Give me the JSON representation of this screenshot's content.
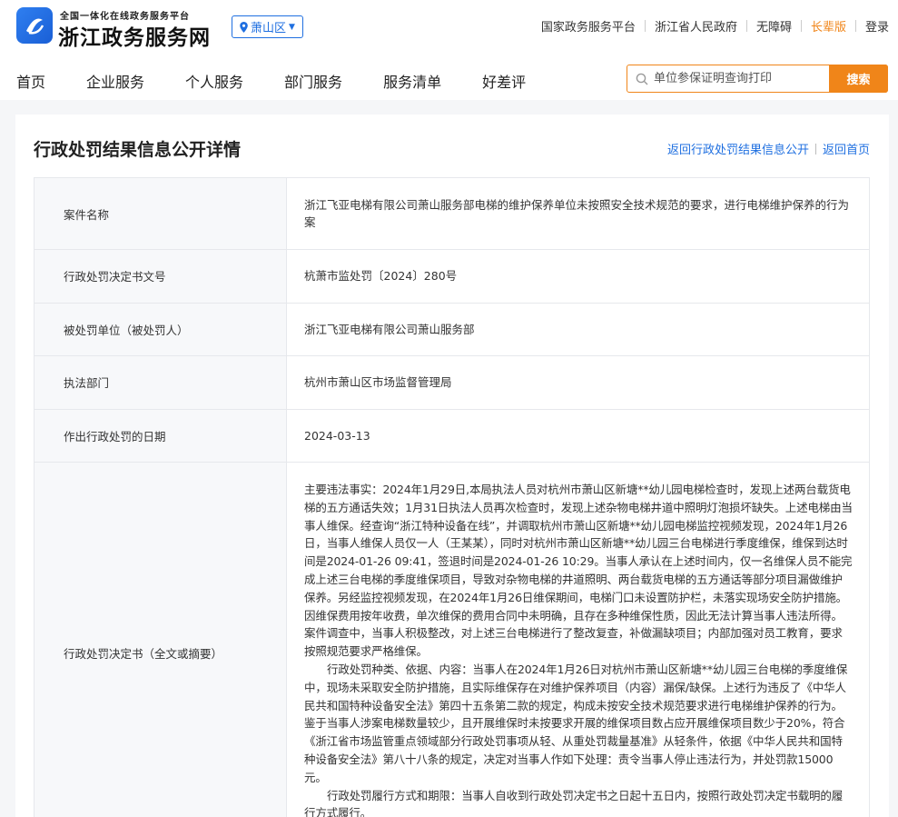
{
  "header": {
    "brand_small": "全国一体化在线政务服务平台",
    "brand_big": "浙江政务服务网",
    "region": "萧山区",
    "top_links": [
      "国家政务服务平台",
      "浙江省人民政府",
      "无障碍",
      "长辈版",
      "登录"
    ],
    "nav": [
      "首页",
      "企业服务",
      "个人服务",
      "部门服务",
      "服务清单",
      "好差评"
    ],
    "search": {
      "placeholder": "单位参保证明查询打印",
      "button": "搜索"
    },
    "colors": {
      "accent": "#f08519",
      "link": "#1f6fe0"
    }
  },
  "page": {
    "title": "行政处罚结果信息公开详情",
    "back_list": "返回行政处罚结果信息公开",
    "back_home": "返回首页"
  },
  "rows": [
    {
      "key": "案件名称",
      "value": "浙江飞亚电梯有限公司萧山服务部电梯的维护保养单位未按照安全技术规范的要求，进行电梯维护保养的行为案"
    },
    {
      "key": "行政处罚决定书文号",
      "value": "杭萧市监处罚〔2024〕280号"
    },
    {
      "key": "被处罚单位（被处罚人）",
      "value": "浙江飞亚电梯有限公司萧山服务部"
    },
    {
      "key": "执法部门",
      "value": "杭州市萧山区市场监督管理局"
    },
    {
      "key": "作出行政处罚的日期",
      "value": "2024-03-13"
    },
    {
      "key": "行政处罚决定书（全文或摘要）",
      "paragraphs": [
        "主要违法事实：2024年1月29日,本局执法人员对杭州市萧山区新塘**幼儿园电梯检查时，发现上述两台载货电梯的五方通话失效；1月31日执法人员再次检查时，发现上述杂物电梯井道中照明灯泡损坏缺失。上述电梯由当事人维保。经查询“浙江特种设备在线”，并调取杭州市萧山区新塘**幼儿园电梯监控视频发现，2024年1月26日，当事人维保人员仅一人（王某某），同时对杭州市萧山区新塘**幼儿园三台电梯进行季度维保，维保到达时间是2024-01-26 09:41，签退时间是2024-01-26 10:29。当事人承认在上述时间内，仅一名维保人员不能完成上述三台电梯的季度维保项目，导致对杂物电梯的井道照明、两台载货电梯的五方通话等部分项目漏做维护保养。另经监控视频发现，在2024年1月26日维保期间，电梯门口未设置防护栏，未落实现场安全防护措施。因维保费用按年收费，单次维保的费用合同中未明确，且存在多种维保性质，因此无法计算当事人违法所得。案件调查中，当事人积极整改，对上述三台电梯进行了整改复查，补做漏缺项目；内部加强对员工教育，要求按照规范要求严格维保。",
        "行政处罚种类、依据、内容：当事人在2024年1月26日对杭州市萧山区新塘**幼儿园三台电梯的季度维保中，现场未采取安全防护措施，且实际维保存在对维护保养项目（内容）漏保/缺保。上述行为违反了《中华人民共和国特种设备安全法》第四十五条第二款的规定，构成未按安全技术规范要求进行电梯维护保养的行为。鉴于当事人涉案电梯数量较少，且开展维保时未按要求开展的维保项目数占应开展维保项目数少于20%，符合《浙江省市场监管重点领域部分行政处罚事项从轻、从重处罚裁量基准》从轻条件，依据《中华人民共和国特种设备安全法》第八十八条的规定，决定对当事人作如下处理：责令当事人停止违法行为，并处罚款15000元。",
        "行政处罚履行方式和期限：当事人自收到行政处罚决定书之日起十五日内，按照行政处罚决定书载明的履行方式履行。"
      ]
    }
  ]
}
